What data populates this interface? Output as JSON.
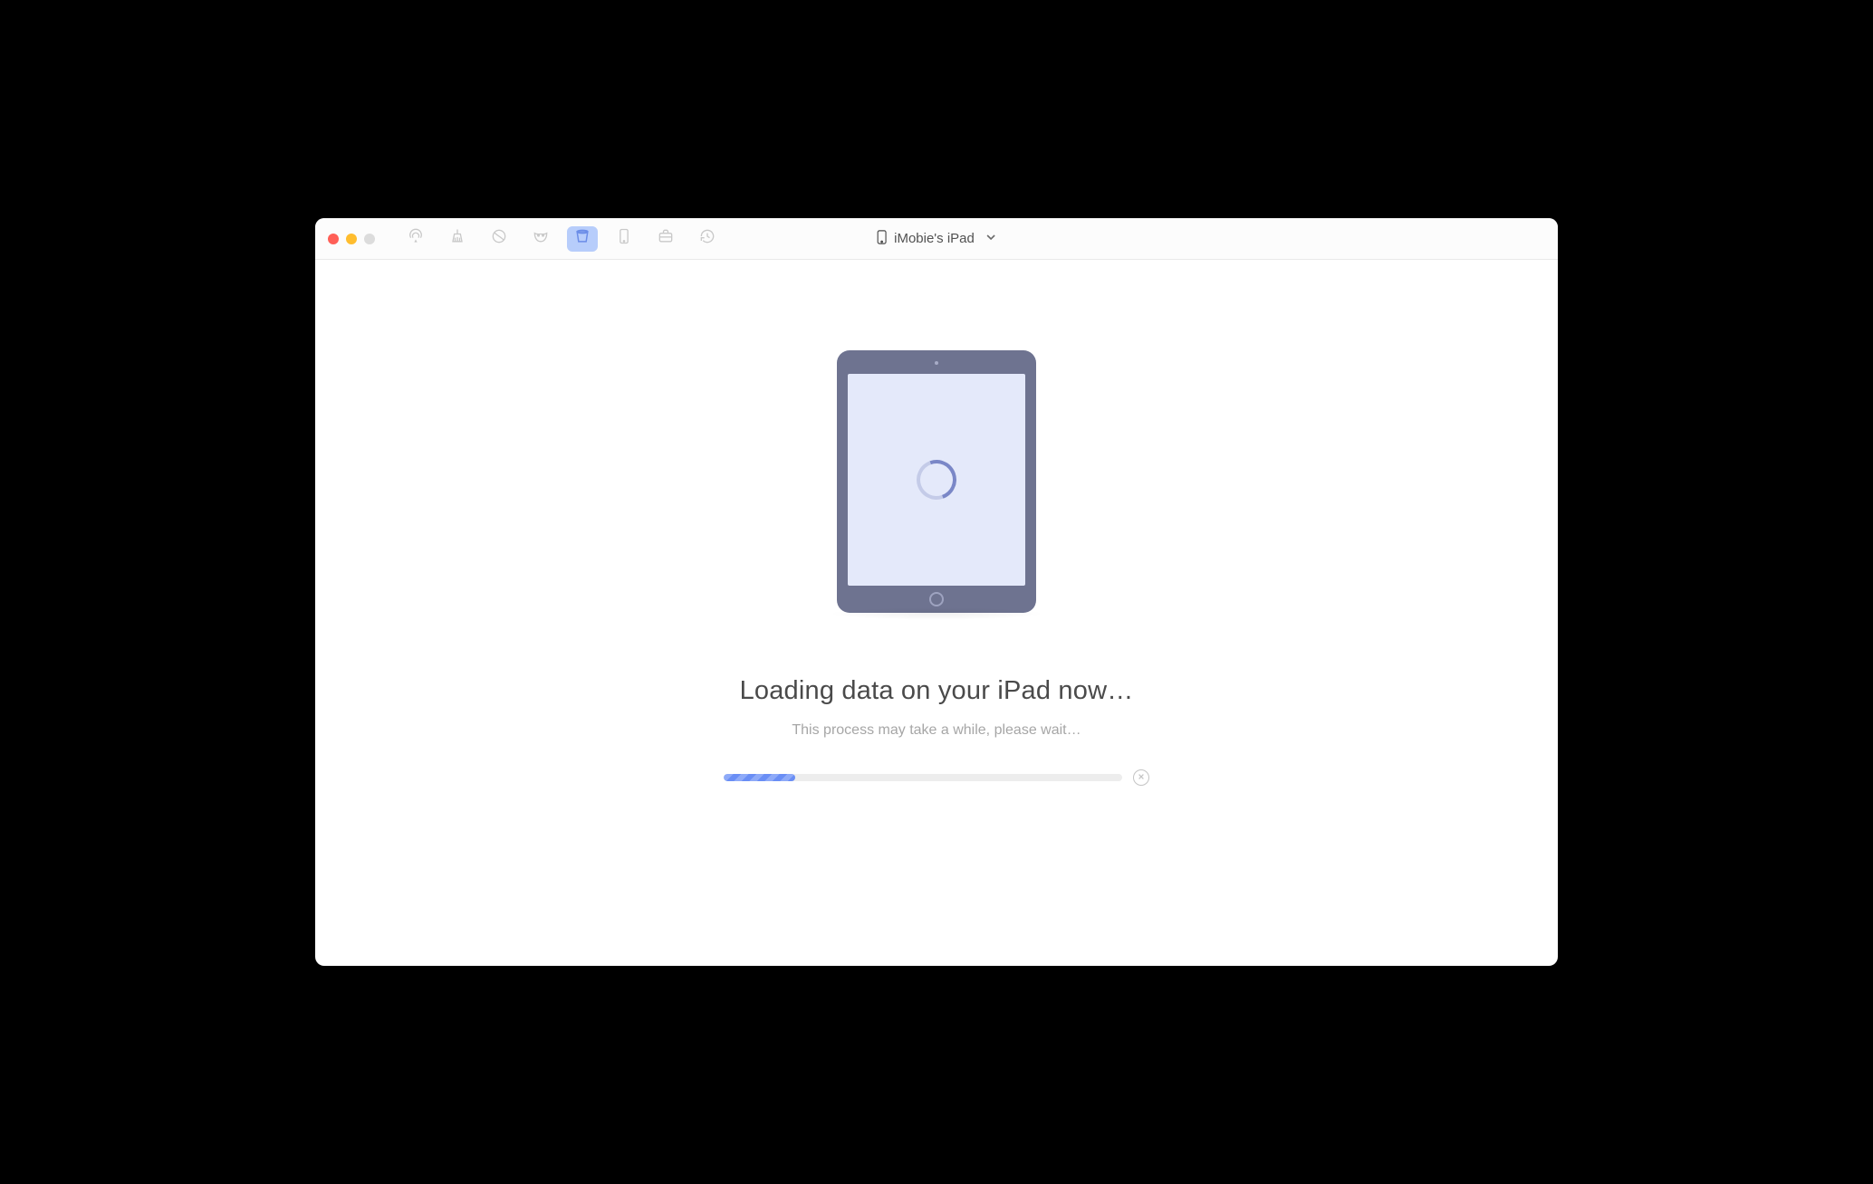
{
  "toolbar": {
    "icons": [
      {
        "name": "airplay-icon"
      },
      {
        "name": "clean-icon"
      },
      {
        "name": "globe-icon"
      },
      {
        "name": "mask-icon"
      },
      {
        "name": "bucket-icon",
        "active": true
      },
      {
        "name": "tablet-icon"
      },
      {
        "name": "briefcase-icon"
      },
      {
        "name": "history-icon"
      }
    ]
  },
  "device": {
    "label": "iMobie's iPad"
  },
  "loading": {
    "title": "Loading data on your iPad now…",
    "subtitle": "This process may take a while, please wait…",
    "progress_percent": 18
  }
}
